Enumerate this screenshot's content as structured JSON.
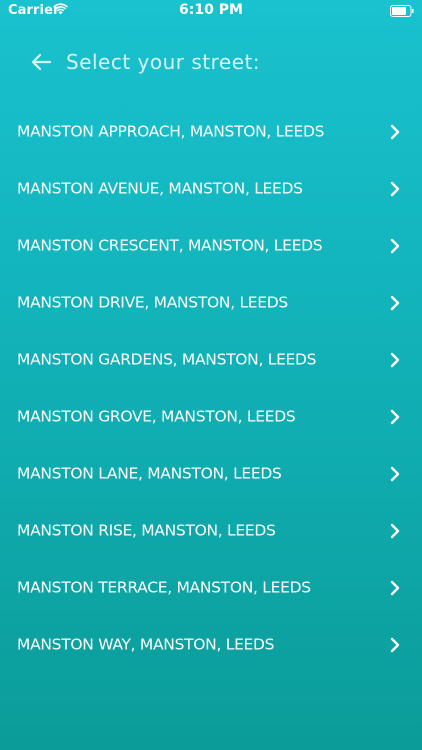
{
  "status_bar": {
    "carrier": "Carrier",
    "time": "6:10 PM",
    "wifi_icon": "wifi-icon",
    "battery_icon": "battery-icon"
  },
  "header": {
    "back_icon": "arrow-left-icon",
    "title": "Select your street:"
  },
  "streets": [
    {
      "label": "MANSTON APPROACH, MANSTON, LEEDS"
    },
    {
      "label": "MANSTON AVENUE, MANSTON, LEEDS"
    },
    {
      "label": "MANSTON CRESCENT, MANSTON, LEEDS"
    },
    {
      "label": "MANSTON DRIVE, MANSTON, LEEDS"
    },
    {
      "label": "MANSTON GARDENS, MANSTON, LEEDS"
    },
    {
      "label": "MANSTON GROVE, MANSTON, LEEDS"
    },
    {
      "label": "MANSTON LANE, MANSTON, LEEDS"
    },
    {
      "label": "MANSTON RISE, MANSTON, LEEDS"
    },
    {
      "label": "MANSTON TERRACE, MANSTON, LEEDS"
    },
    {
      "label": "MANSTON WAY, MANSTON, LEEDS"
    }
  ],
  "row_icon": "chevron-right-icon",
  "colors": {
    "gradient_top": "#19c2cf",
    "gradient_bottom": "#0b9c98",
    "text": "#ffffff"
  }
}
